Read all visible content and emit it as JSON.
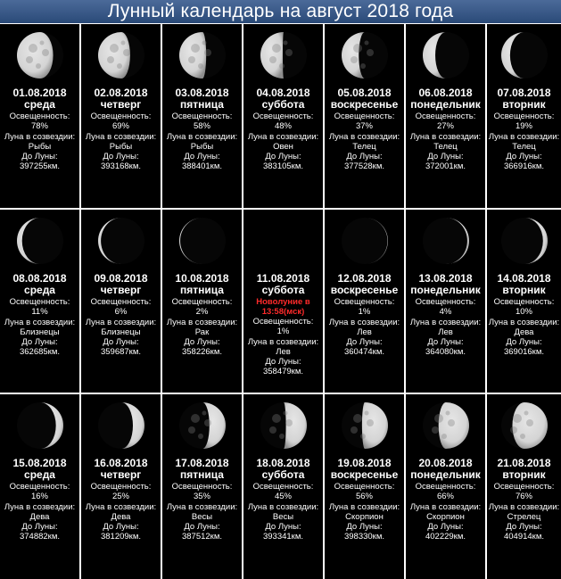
{
  "title": "Лунный календарь на август 2018 года",
  "labels": {
    "illumination": "Освещенность:",
    "constellation": "Луна в созвездии:",
    "distance": "До Луны:"
  },
  "days": [
    {
      "date": "01.08.2018",
      "weekday": "среда",
      "illum": "78%",
      "illum_value": 78,
      "phase": "waning",
      "constellation": "Рыбы",
      "distance": "397255км."
    },
    {
      "date": "02.08.2018",
      "weekday": "четверг",
      "illum": "69%",
      "illum_value": 69,
      "phase": "waning",
      "constellation": "Рыбы",
      "distance": "393168км."
    },
    {
      "date": "03.08.2018",
      "weekday": "пятница",
      "illum": "58%",
      "illum_value": 58,
      "phase": "waning",
      "constellation": "Рыбы",
      "distance": "388401км."
    },
    {
      "date": "04.08.2018",
      "weekday": "суббота",
      "illum": "48%",
      "illum_value": 48,
      "phase": "waning",
      "constellation": "Овен",
      "distance": "383105км."
    },
    {
      "date": "05.08.2018",
      "weekday": "воскресенье",
      "illum": "37%",
      "illum_value": 37,
      "phase": "waning",
      "constellation": "Телец",
      "distance": "377528км."
    },
    {
      "date": "06.08.2018",
      "weekday": "понедельник",
      "illum": "27%",
      "illum_value": 27,
      "phase": "waning",
      "constellation": "Телец",
      "distance": "372001км."
    },
    {
      "date": "07.08.2018",
      "weekday": "вторник",
      "illum": "19%",
      "illum_value": 19,
      "phase": "waning",
      "constellation": "Телец",
      "distance": "366916км."
    },
    {
      "date": "08.08.2018",
      "weekday": "среда",
      "illum": "11%",
      "illum_value": 11,
      "phase": "waning",
      "constellation": "Близнецы",
      "distance": "362685км."
    },
    {
      "date": "09.08.2018",
      "weekday": "четверг",
      "illum": "6%",
      "illum_value": 6,
      "phase": "waning",
      "constellation": "Близнецы",
      "distance": "359687км."
    },
    {
      "date": "10.08.2018",
      "weekday": "пятница",
      "illum": "2%",
      "illum_value": 2,
      "phase": "waning",
      "constellation": "Рак",
      "distance": "358226км."
    },
    {
      "date": "11.08.2018",
      "weekday": "суббота",
      "event_line1": "Новолуние в",
      "event_line2": "13:58(мск)",
      "illum": "1%",
      "illum_value": 0,
      "phase": "new",
      "constellation": "Лев",
      "distance": "358479км."
    },
    {
      "date": "12.08.2018",
      "weekday": "воскресенье",
      "illum": "1%",
      "illum_value": 1,
      "phase": "waxing",
      "constellation": "Лев",
      "distance": "360474км."
    },
    {
      "date": "13.08.2018",
      "weekday": "понедельник",
      "illum": "4%",
      "illum_value": 4,
      "phase": "waxing",
      "constellation": "Лев",
      "distance": "364080км."
    },
    {
      "date": "14.08.2018",
      "weekday": "вторник",
      "illum": "10%",
      "illum_value": 10,
      "phase": "waxing",
      "constellation": "Дева",
      "distance": "369016км."
    },
    {
      "date": "15.08.2018",
      "weekday": "среда",
      "illum": "16%",
      "illum_value": 16,
      "phase": "waxing",
      "constellation": "Дева",
      "distance": "374882км."
    },
    {
      "date": "16.08.2018",
      "weekday": "четверг",
      "illum": "25%",
      "illum_value": 25,
      "phase": "waxing",
      "constellation": "Дева",
      "distance": "381209км."
    },
    {
      "date": "17.08.2018",
      "weekday": "пятница",
      "illum": "35%",
      "illum_value": 35,
      "phase": "waxing",
      "constellation": "Весы",
      "distance": "387512км."
    },
    {
      "date": "18.08.2018",
      "weekday": "суббота",
      "illum": "45%",
      "illum_value": 45,
      "phase": "waxing",
      "constellation": "Весы",
      "distance": "393341км."
    },
    {
      "date": "19.08.2018",
      "weekday": "воскресенье",
      "illum": "56%",
      "illum_value": 56,
      "phase": "waxing",
      "constellation": "Скорпион",
      "distance": "398330км."
    },
    {
      "date": "20.08.2018",
      "weekday": "понедельник",
      "illum": "66%",
      "illum_value": 66,
      "phase": "waxing",
      "constellation": "Скорпион",
      "distance": "402229км."
    },
    {
      "date": "21.08.2018",
      "weekday": "вторник",
      "illum": "76%",
      "illum_value": 76,
      "phase": "waxing",
      "constellation": "Стрелец",
      "distance": "404914км."
    }
  ],
  "colors": {
    "title_bg": "#3a5a8a",
    "cell_bg": "#000000",
    "text": "#ffffff",
    "event": "#ff2a2a",
    "moon_light": "#d4d4d4",
    "moon_shadow": "#050505"
  }
}
